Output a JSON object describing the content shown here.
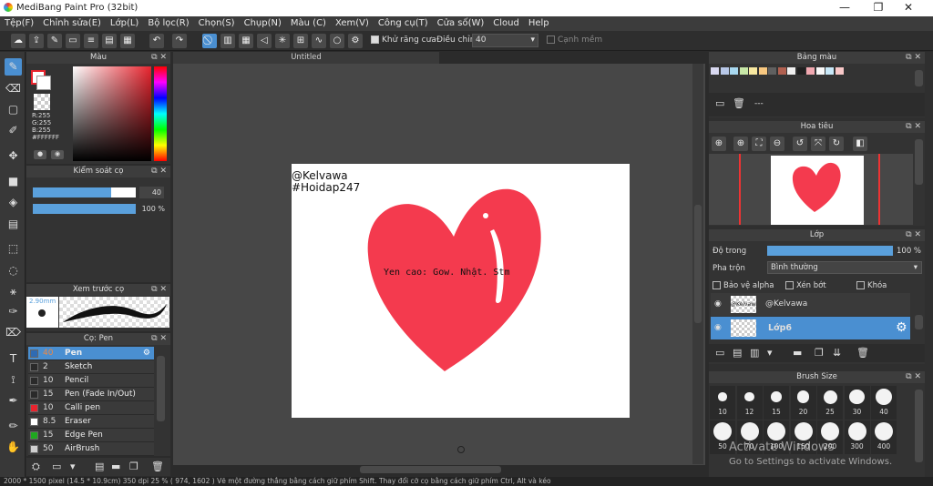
{
  "window": {
    "title": "MediBang Paint Pro (32bit)",
    "controls": [
      "—",
      "❐",
      "✕"
    ]
  },
  "menu": [
    "Tệp(F)",
    "Chỉnh sửa(E)",
    "Lớp(L)",
    "Bộ lọc(R)",
    "Chọn(S)",
    "Chụp(N)",
    "Màu (C)",
    "Xem(V)",
    "Công cụ(T)",
    "Cửa số(W)",
    "Cloud",
    "Help"
  ],
  "toolbar": {
    "antialias_label": "Khử răng cưa",
    "correction_label": "Điều chỉnh",
    "correction_value": "40",
    "edge_label": "Cạnh mềm"
  },
  "color_panel": {
    "title": "Màu",
    "r": "R:255",
    "g": "G:255",
    "b": "B:255",
    "hex": "#FFFFFF",
    "primary": "#e8242e",
    "secondary": "#ffffff"
  },
  "brush_control": {
    "title": "Kiểm soát cọ",
    "size": "40",
    "opacity": "100 %",
    "size_fraction": 0.76,
    "opacity_fraction": 1.0
  },
  "brush_preview": {
    "title": "Xem trước cọ",
    "size_text": "2.90mm"
  },
  "brush_panel": {
    "title": "Cọ: Pen",
    "items": [
      {
        "size": "40",
        "name": "Pen",
        "color": "#2f6bb3"
      },
      {
        "size": "2",
        "name": "Sketch",
        "color": "#2a2a2a"
      },
      {
        "size": "10",
        "name": "Pencil",
        "color": "#2a2a2a"
      },
      {
        "size": "15",
        "name": "Pen (Fade In/Out)",
        "color": "#2a2a2a"
      },
      {
        "size": "10",
        "name": "Calli pen",
        "color": "#e8242e"
      },
      {
        "size": "8.5",
        "name": "Eraser",
        "color": "#ffffff"
      },
      {
        "size": "15",
        "name": "Edge Pen",
        "color": "#1fa81f"
      },
      {
        "size": "50",
        "name": "AirBrush",
        "color": "#cfcfcf"
      }
    ]
  },
  "canvas": {
    "tab": "Untitled",
    "text1": "@Kelvawa",
    "text2": "#Hoidap247",
    "heart_text": "Yen cao: Gow. Nhật. Stm",
    "heart_color": "#f43a4e"
  },
  "palette": {
    "title": "Bảng màu",
    "colors": [
      "#d8d8f0",
      "#b8c8e8",
      "#a8d8f0",
      "#c8e8a8",
      "#f8e8a0",
      "#f8c880",
      "#606060",
      "#b06050",
      "#f0f0f0",
      "#202020",
      "#f0a8b0",
      "#f8f8f8",
      "#c8e8f8",
      "#f8c8c8"
    ],
    "menu_text": "---"
  },
  "navigator": {
    "title": "Hoa tiêu"
  },
  "layers_panel": {
    "title": "Lớp",
    "opacity_label": "Độ trong",
    "opacity_value": "100 %",
    "blend_label": "Pha trộn",
    "blend_value": "Bình thường",
    "protect_alpha": "Bảo vệ alpha",
    "clipping": "Xén bớt",
    "lock": "Khóa",
    "layers": [
      {
        "name": "@Kelvawa",
        "thumb": "@Kelvawa"
      },
      {
        "name": "Lớp6",
        "thumb": ""
      }
    ]
  },
  "brush_size_panel": {
    "title": "Brush Size",
    "sizes": [
      "10",
      "12",
      "15",
      "20",
      "25",
      "30",
      "40",
      "50",
      "70",
      "100",
      "150",
      "200",
      "300",
      "400"
    ]
  },
  "statusbar": "2000 * 1500 pixel  (14.5 * 10.9cm)  350 dpi  25 %  ( 974, 1602 )  Vẽ một đường thẳng bằng cách giữ phím Shift. Thay đổi cỡ cọ bằng cách giữ phím Ctrl, Alt và kéo",
  "watermark": {
    "line1": "Activate Windows",
    "line2": "Go to Settings to activate Windows."
  }
}
